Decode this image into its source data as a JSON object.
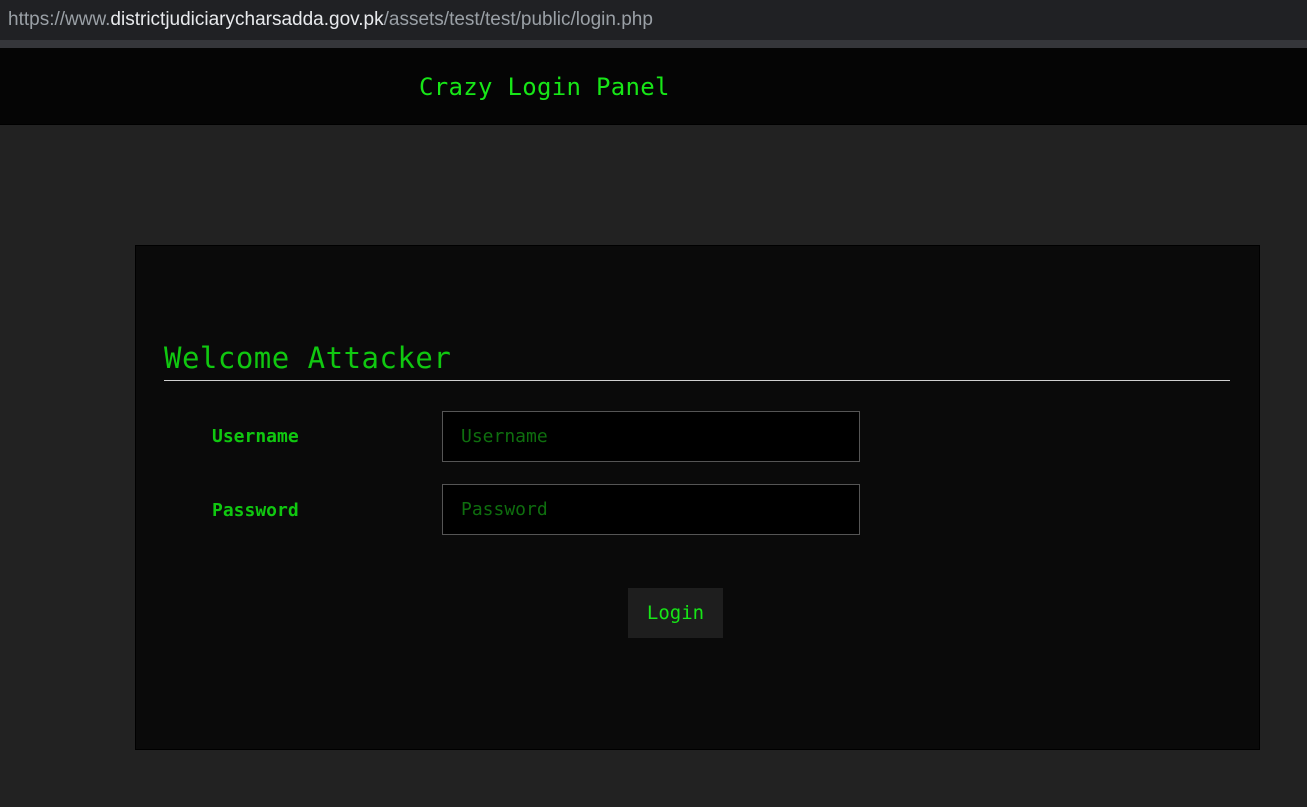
{
  "browser": {
    "url_prefix": "https://www.",
    "url_host": "districtjudiciarycharsadda.gov.pk",
    "url_path": "/assets/test/test/public/login.php"
  },
  "nav": {
    "brand": "Crazy Login Panel"
  },
  "panel": {
    "title": "Welcome Attacker",
    "username_label": "Username",
    "username_placeholder": "Username",
    "username_value": "",
    "password_label": "Password",
    "password_placeholder": "Password",
    "password_value": "",
    "login_label": "Login"
  },
  "colors": {
    "accent_green": "#10c810",
    "page_background": "#222222",
    "panel_background": "#0a0a0a"
  }
}
